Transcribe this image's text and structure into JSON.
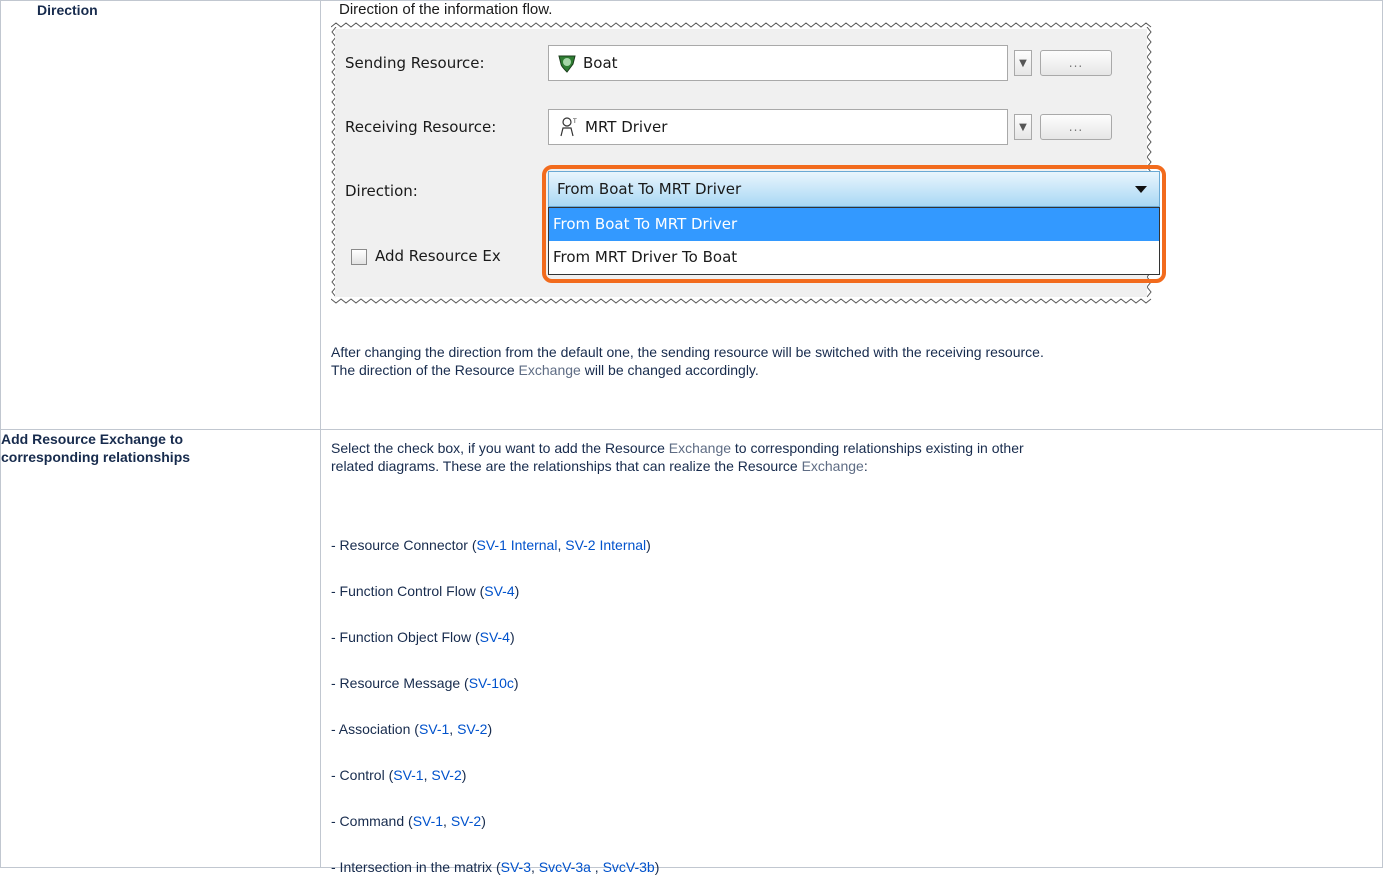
{
  "rows": [
    {
      "label": "Direction",
      "caption": "Direction of the information flow.",
      "dialog": {
        "sending_label": "Sending Resource:",
        "sending_value": "Boat",
        "receiving_label": "Receiving Resource:",
        "receiving_value": "MRT Driver",
        "direction_label": "Direction:",
        "direction_value": "From Boat To MRT Driver",
        "options": [
          "From Boat To MRT Driver",
          "From MRT Driver To Boat"
        ],
        "checkbox_label": "Add Resource Ex",
        "ellipsis": "...",
        "highlight_color": "#f26b1d",
        "selected_color": "#3399ff"
      },
      "note_line1": "After changing the direction from the default one, the sending resource will be switched with the receiving resource.",
      "note_line2_a": "The direction of the Resource ",
      "note_line2_b": "Exchange",
      "note_line2_c": " will be changed accordingly."
    },
    {
      "label_line1": "Add Resource Exchange to",
      "label_line2": "corresponding relationships",
      "intro_line1_a": "Select the check box, if you want to add the Resource ",
      "intro_line1_b": "Exchange",
      "intro_line1_c": " to corresponding relationships existing in other",
      "intro_line2_a": "related diagrams. These are the relationships that can realize the Resource ",
      "intro_line2_b": "Exchange",
      "intro_line2_c": ":",
      "items": [
        {
          "prefix": "- Resource Connector (",
          "links": [
            "SV-1 Internal",
            "SV-2 Internal"
          ],
          "seps": [
            ", "
          ],
          "suffix": ")"
        },
        {
          "prefix": "- Function Control Flow (",
          "links": [
            "SV-4"
          ],
          "seps": [],
          "suffix": ")"
        },
        {
          "prefix": "- Function Object Flow (",
          "links": [
            "SV-4"
          ],
          "seps": [],
          "suffix": ")"
        },
        {
          "prefix": "- Resource Message (",
          "links": [
            "SV-10c"
          ],
          "seps": [],
          "suffix": ")"
        },
        {
          "prefix": "- Association (",
          "links": [
            "SV-1",
            "SV-2"
          ],
          "seps": [
            ", "
          ],
          "suffix": ")"
        },
        {
          "prefix": "- Control (",
          "links": [
            "SV-1",
            "SV-2"
          ],
          "seps": [
            ", "
          ],
          "suffix": ")"
        },
        {
          "prefix": "- Command (",
          "links": [
            "SV-1",
            "SV-2"
          ],
          "seps": [
            ", "
          ],
          "suffix": ")"
        },
        {
          "prefix": "- Intersection in the matrix (",
          "links": [
            "SV-3",
            "SvcV-3a",
            "SvcV-3b"
          ],
          "seps": [
            ", ",
            "  , "
          ],
          "suffix": ")"
        }
      ]
    }
  ]
}
